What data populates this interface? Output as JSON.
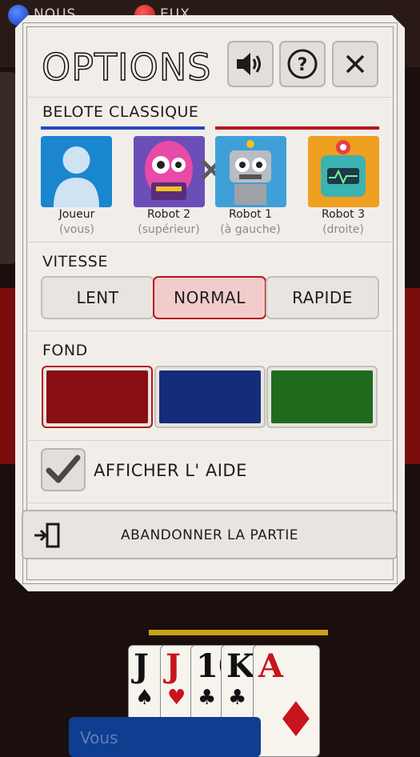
{
  "background": {
    "team_us": "NOUS",
    "team_them": "EUX",
    "you_label": "Vous",
    "hand": [
      {
        "rank": "J",
        "suit": "♠",
        "color": "black"
      },
      {
        "rank": "J",
        "suit": "♥",
        "color": "red"
      },
      {
        "rank": "10",
        "suit": "♣",
        "color": "black"
      },
      {
        "rank": "K",
        "suit": "♣",
        "color": "black"
      },
      {
        "rank": "A",
        "suit": "♦",
        "color": "red"
      }
    ]
  },
  "modal": {
    "title": "OPTIONS",
    "buttons": {
      "sound_icon": "speaker-icon",
      "help_icon": "question-icon",
      "close_icon": "close-icon"
    },
    "game_mode": "BELOTE CLASSIQUE",
    "team_colors": {
      "us": "#2b45c9",
      "them": "#b8161c"
    },
    "players": [
      {
        "name": "Joueur",
        "position": "(vous)"
      },
      {
        "name": "Robot 2",
        "position": "(supérieur)"
      },
      {
        "name": "Robot 1",
        "position": "(à gauche)"
      },
      {
        "name": "Robot 3",
        "position": "(droite)"
      }
    ],
    "speed": {
      "label": "VITESSE",
      "options": [
        "LENT",
        "NORMAL",
        "RAPIDE"
      ],
      "selected": "NORMAL"
    },
    "background": {
      "label": "FOND",
      "colors": [
        "#8a0f12",
        "#152c7a",
        "#1f6b1e"
      ],
      "selected_index": 0
    },
    "show_help": {
      "label": "AFFICHER L' AIDE",
      "checked": true
    },
    "abandon_label": "ABANDONNER LA PARTIE"
  }
}
